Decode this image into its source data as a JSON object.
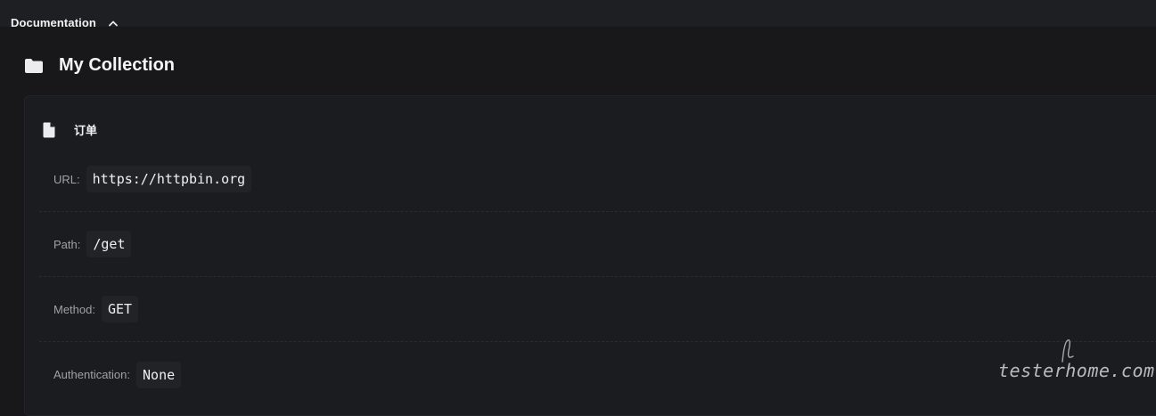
{
  "section": {
    "title": "Documentation",
    "toggle_icon": "chevron-up-icon"
  },
  "collection": {
    "title": "My Collection",
    "icon": "folder-icon"
  },
  "request": {
    "name": "订单",
    "icon": "file-icon",
    "fields": {
      "url": {
        "label": "URL:",
        "value": "https://httpbin.org"
      },
      "path": {
        "label": "Path:",
        "value": "/get"
      },
      "method": {
        "label": "Method:",
        "value": "GET"
      },
      "auth": {
        "label": "Authentication:",
        "value": "None"
      }
    }
  },
  "watermark": {
    "text": "testerhome.com"
  },
  "colors": {
    "background": "#18181b",
    "topbar": "#1e1f22",
    "card": "#1b1c1f",
    "label": "#a0a0a6",
    "value_bg": "#222327"
  }
}
